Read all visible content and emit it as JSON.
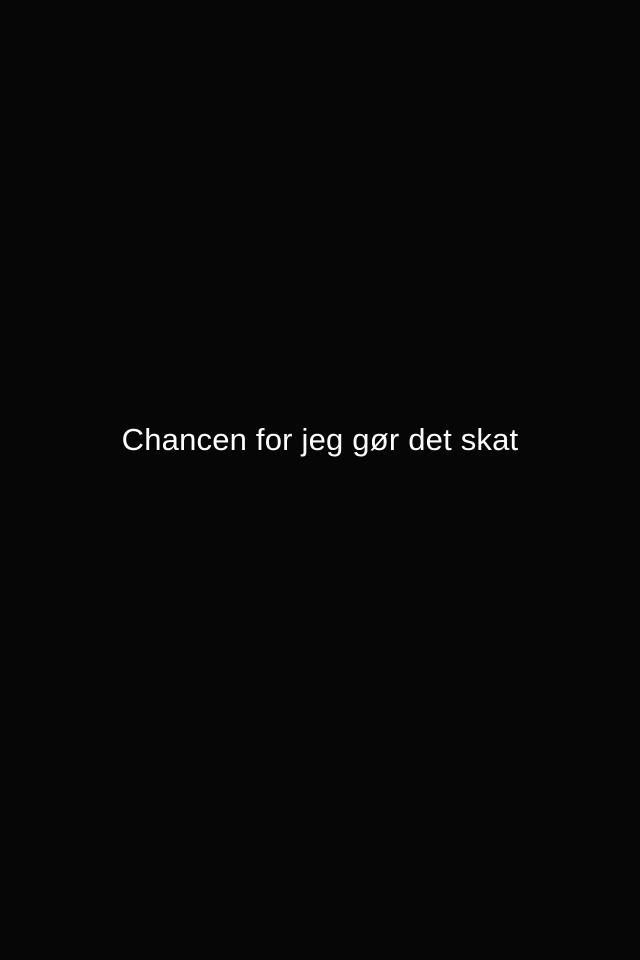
{
  "screen": {
    "background_color": "#060606",
    "text_color": "#ffffff"
  },
  "caption": {
    "text": "Chancen for jeg gør det skat"
  }
}
